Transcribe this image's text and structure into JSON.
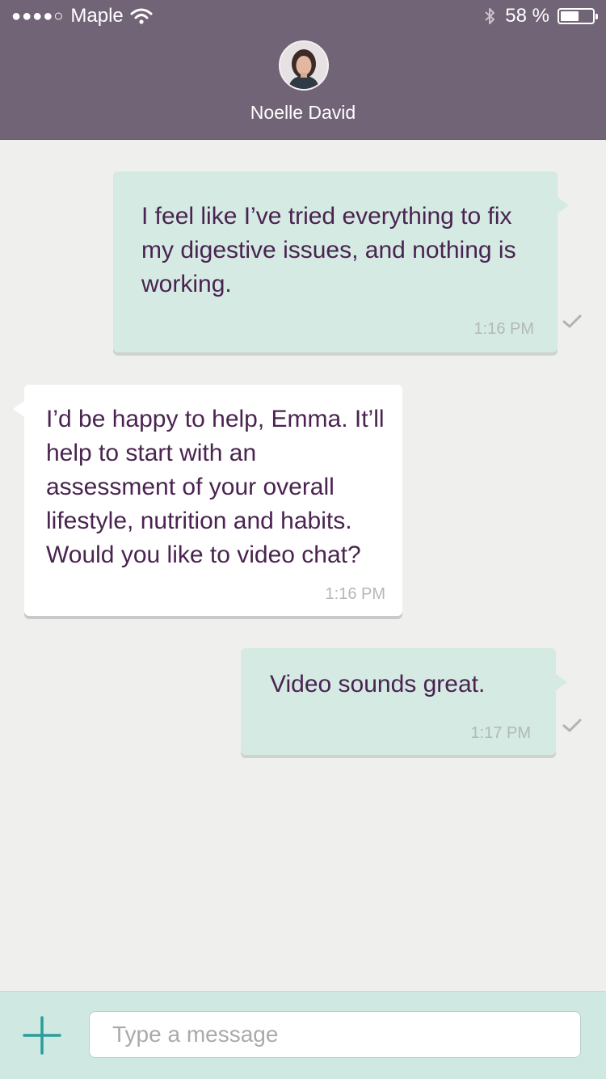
{
  "status_bar": {
    "signal_dots": "●●●●○",
    "carrier": "Maple",
    "battery_percent": "58 %",
    "battery_level": 0.58,
    "icons": [
      "wifi-icon",
      "bluetooth-icon",
      "battery-icon"
    ]
  },
  "header": {
    "contact_name": "Noelle David",
    "avatar": "contact-avatar"
  },
  "messages": [
    {
      "direction": "outgoing",
      "text": "I feel like I’ve tried everything to fix my digestive issues, and nothing is working.",
      "time": "1:16 PM",
      "status_icon": "checkmark-icon"
    },
    {
      "direction": "incoming",
      "text": "I’d be happy to help, Emma. It’ll help to start with an assessment of your overall lifestyle, nutrition and habits. Would you like to video chat?",
      "time": "1:16 PM"
    },
    {
      "direction": "outgoing",
      "text": "Video sounds great.",
      "time": "1:17 PM",
      "status_icon": "checkmark-icon"
    }
  ],
  "composer": {
    "add_icon": "plus-icon",
    "input_value": "",
    "input_placeholder": "Type a message"
  },
  "colors": {
    "header_bg": "#716476",
    "chat_bg": "#efefee",
    "outgoing_bubble": "#d4eae3",
    "incoming_bubble": "#ffffff",
    "message_text": "#4a2350",
    "composer_bg": "#cfe9e2",
    "accent": "#2a9d9a"
  }
}
